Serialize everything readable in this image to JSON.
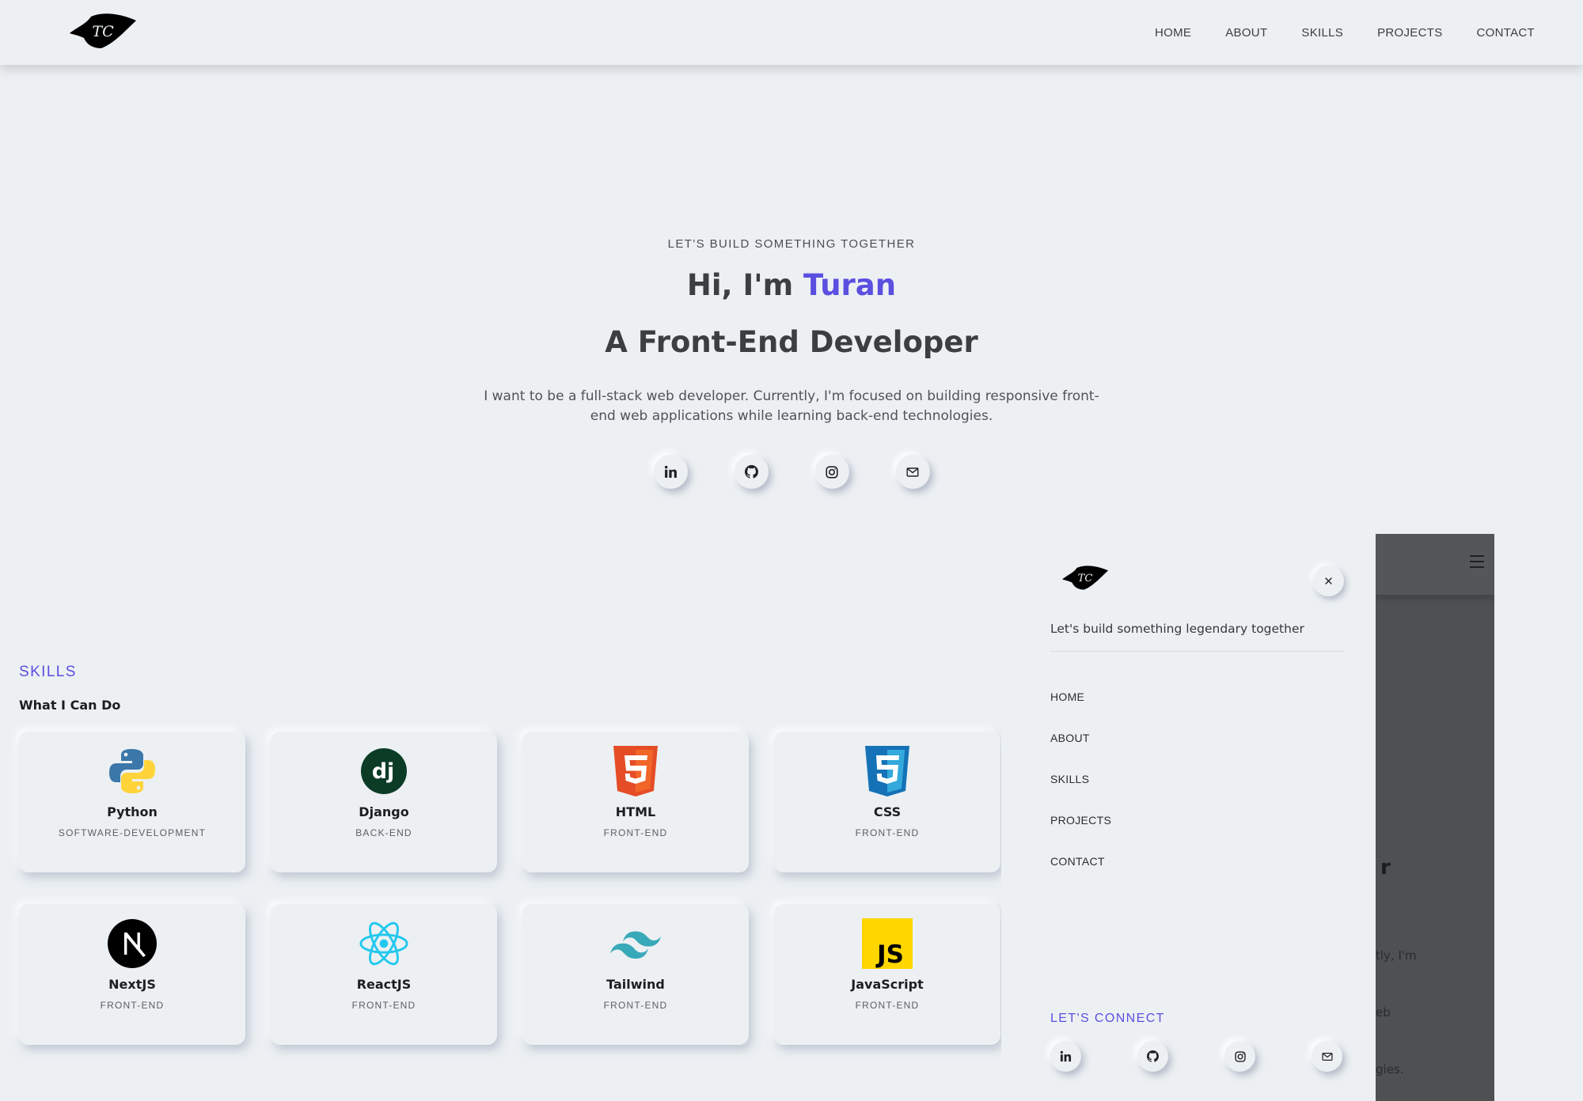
{
  "header": {
    "logo_alt": "TC",
    "nav": [
      "HOME",
      "ABOUT",
      "SKILLS",
      "PROJECTS",
      "CONTACT"
    ]
  },
  "hero": {
    "kicker": "LET'S BUILD SOMETHING TOGETHER",
    "greeting": "Hi, I'm ",
    "name": "Turan",
    "role": "A Front-End Developer",
    "description": "I want to be a full-stack web developer. Currently, I'm focused on building responsive front-end web applications while learning back-end technologies.",
    "social": [
      "linkedin-icon",
      "github-icon",
      "instagram-icon",
      "mail-icon"
    ]
  },
  "skills": {
    "kicker": "SKILLS",
    "title": "What I Can Do",
    "items": [
      {
        "name": "Python",
        "category": "SOFTWARE-DEVELOPMENT",
        "icon": "python-icon"
      },
      {
        "name": "Django",
        "category": "BACK-END",
        "icon": "django-icon"
      },
      {
        "name": "HTML",
        "category": "FRONT-END",
        "icon": "html5-icon"
      },
      {
        "name": "CSS",
        "category": "FRONT-END",
        "icon": "css3-icon"
      },
      {
        "name": "NextJS",
        "category": "FRONT-END",
        "icon": "nextjs-icon"
      },
      {
        "name": "ReactJS",
        "category": "FRONT-END",
        "icon": "react-icon"
      },
      {
        "name": "Tailwind",
        "category": "FRONT-END",
        "icon": "tailwind-icon"
      },
      {
        "name": "JavaScript",
        "category": "FRONT-END",
        "icon": "javascript-icon"
      }
    ]
  },
  "panel": {
    "logo_alt": "TC",
    "close_label": "✕",
    "tagline": "Let's build something legendary together",
    "nav": [
      "HOME",
      "ABOUT",
      "SKILLS",
      "PROJECTS",
      "CONTACT"
    ],
    "connect_label": "LET'S CONNECT",
    "social": [
      "linkedin-icon",
      "github-icon",
      "instagram-icon",
      "mail-icon"
    ]
  },
  "background_view": {
    "heading_fragment": "r",
    "text_fragment_lines": [
      "tly, I'm",
      "eb",
      "gies."
    ]
  },
  "colors": {
    "background": "#ecf0f3",
    "accent": "#5b4fe0",
    "text": "#3c3e41",
    "overlay": "#4f5052"
  }
}
